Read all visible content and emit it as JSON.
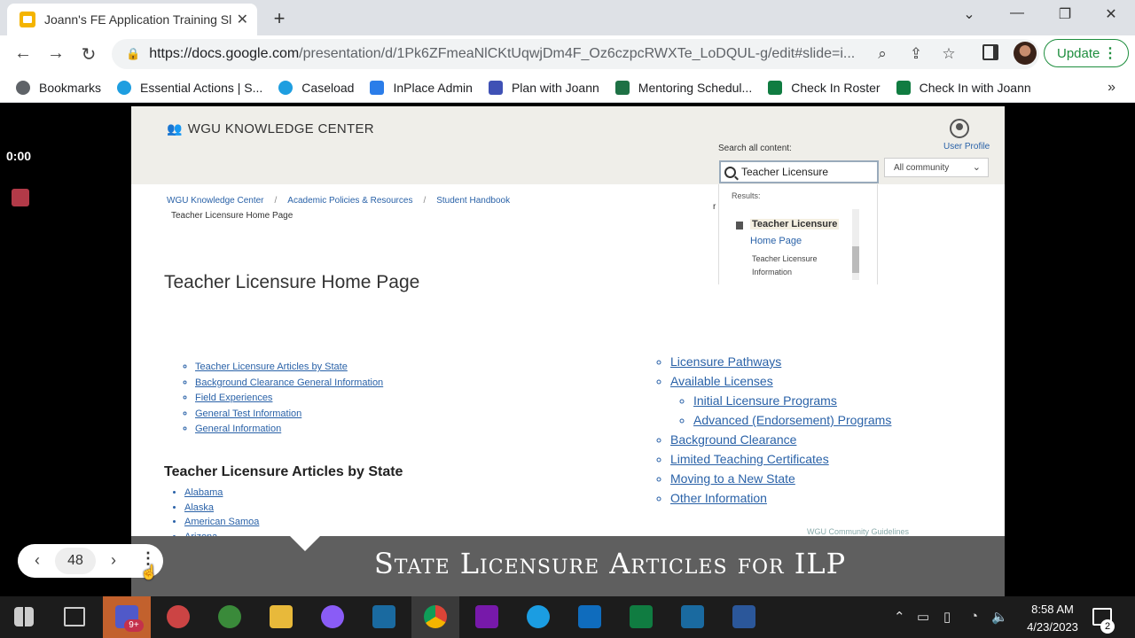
{
  "browser": {
    "tab_title": "Joann's FE Application Training Sl",
    "url_host": "https://docs.google.com",
    "url_path": "/presentation/d/1Pk6ZFmeaNlCKtUqwjDm4F_Oz6czpcRWXTe_LoDQUL-g/edit#slide=i...",
    "update_label": "Update",
    "bookmarks": [
      {
        "label": "Bookmarks",
        "color": "#5f6368"
      },
      {
        "label": "Essential Actions | S...",
        "color": "#1e9ee0"
      },
      {
        "label": "Caseload",
        "color": "#1e9ee0"
      },
      {
        "label": "InPlace Admin",
        "color": "#2b7de9"
      },
      {
        "label": "Plan with Joann",
        "color": "#3f51b5"
      },
      {
        "label": "Mentoring Schedul...",
        "color": "#1e7145"
      },
      {
        "label": "Check In Roster",
        "color": "#107c41"
      },
      {
        "label": "Check In with Joann",
        "color": "#107c41"
      }
    ]
  },
  "player": {
    "timer": "0:00",
    "slide_number": "48"
  },
  "slide": {
    "logo_text": "WGU KNOWLEDGE CENTER",
    "user_profile": "User Profile",
    "search_label": "Search all content:",
    "search_value": "Teacher Licensure",
    "community_select": "All community",
    "results_label": "Results:",
    "result_title_1": "Teacher Licensure",
    "result_title_2": "Home Page",
    "result_sub": "Teacher Licensure Information",
    "crumbs": [
      "WGU Knowledge Center",
      "Academic Policies & Resources",
      "Student Handbook"
    ],
    "crumb_current": "Teacher Licensure Home Page",
    "cut_text": "r",
    "page_title": "Teacher Licensure Home Page",
    "left_links": [
      "Teacher Licensure Articles by State",
      "Background Clearance General Information",
      "Field Experiences",
      "General Test Information",
      "General Information"
    ],
    "right_links": {
      "pathways": "Licensure Pathways",
      "available": "Available Licenses",
      "initial": "Initial Licensure Programs",
      "advanced": "Advanced (Endorsement) Programs",
      "background": "Background Clearance",
      "limited": "Limited Teaching Certificates",
      "moving": "Moving to a New State",
      "other": "Other Information"
    },
    "states_heading": "Teacher Licensure Articles by State",
    "states": [
      "Alabama",
      "Alaska",
      "American Samoa",
      "Arizona"
    ],
    "faint_text": "WGU Community Guidelines",
    "caption": "State Licensure Articles for ILP"
  },
  "taskbar": {
    "teams_badge": "9+",
    "time": "8:58 AM",
    "date": "4/23/2023",
    "notifications": "2"
  }
}
